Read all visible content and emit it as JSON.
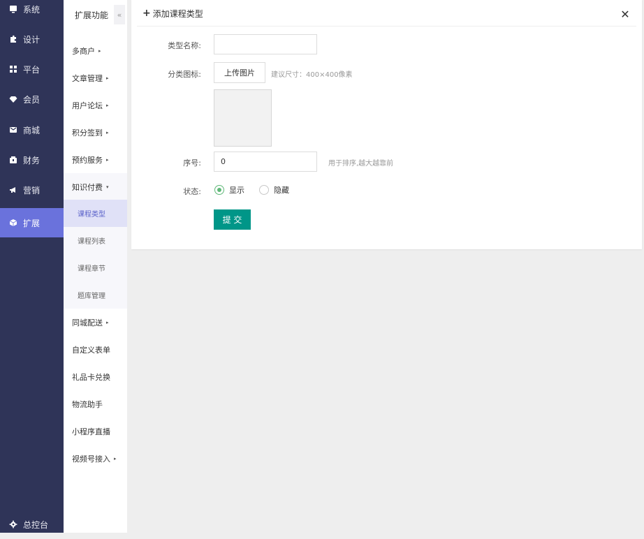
{
  "nav": {
    "items": [
      {
        "label": "系统",
        "icon": "monitor-icon"
      },
      {
        "label": "设计",
        "icon": "puzzle-icon"
      },
      {
        "label": "平台",
        "icon": "grid-icon"
      },
      {
        "label": "会员",
        "icon": "diamond-icon"
      },
      {
        "label": "商城",
        "icon": "mail-icon"
      },
      {
        "label": "财务",
        "icon": "wallet-icon"
      },
      {
        "label": "营销",
        "icon": "megaphone-icon"
      },
      {
        "label": "扩展",
        "icon": "cube-icon",
        "active": true
      }
    ],
    "footer": {
      "label": "总控台",
      "icon": "gear-icon"
    },
    "active_color": "#6a72dc",
    "bg_color": "#2f3458"
  },
  "submenu": {
    "title": "扩展功能",
    "collapse_icon": "«",
    "items": [
      {
        "label": "多商户",
        "arrow": "▸"
      },
      {
        "label": "文章管理",
        "arrow": "▸"
      },
      {
        "label": "用户论坛",
        "arrow": "▸"
      },
      {
        "label": "积分签到",
        "arrow": "▸"
      },
      {
        "label": "预约服务",
        "arrow": "▸"
      },
      {
        "label": "知识付费",
        "arrow": "▾"
      }
    ],
    "children": [
      {
        "label": "课程类型",
        "active": true
      },
      {
        "label": "课程列表"
      },
      {
        "label": "课程章节"
      },
      {
        "label": "题库管理"
      }
    ],
    "items_after": [
      {
        "label": "同城配送",
        "arrow": "▸"
      },
      {
        "label": "自定义表单",
        "arrow": ""
      },
      {
        "label": "礼品卡兑换",
        "arrow": ""
      },
      {
        "label": "物流助手",
        "arrow": ""
      },
      {
        "label": "小程序直播",
        "arrow": ""
      },
      {
        "label": "视频号接入",
        "arrow": "▸"
      }
    ]
  },
  "dialog": {
    "title": "添加课程类型",
    "plus": "+",
    "close": "✕",
    "name_label": "类型名称:",
    "name_value": "",
    "icon_label": "分类图标:",
    "upload_label": "上传图片",
    "upload_hint": "建议尺寸：400×400像素",
    "sort_label": "序号:",
    "sort_value": "0",
    "sort_hint": "用于排序,越大越靠前",
    "status_label": "状态:",
    "status_options": [
      "显示",
      "隐藏"
    ],
    "status_selected": "显示",
    "submit_label": "提 交",
    "submit_color": "#009688"
  }
}
